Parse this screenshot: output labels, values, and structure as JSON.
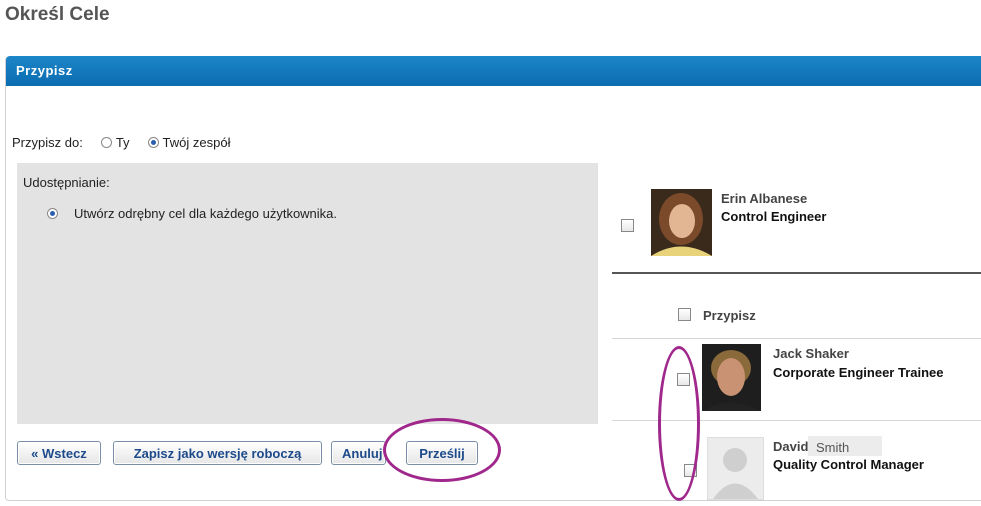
{
  "page": {
    "title": "Określ Cele"
  },
  "panel": {
    "header": "Przypisz"
  },
  "assign": {
    "label": "Przypisz do:",
    "options": [
      {
        "label": "Ty",
        "selected": false
      },
      {
        "label": "Twój zespół",
        "selected": true
      }
    ]
  },
  "sharing": {
    "label": "Udostępnianie:",
    "option": "Utwórz odrębny cel dla każdego użytkownika.",
    "option_selected": true
  },
  "buttons": {
    "back": "« Wstecz",
    "save_draft": "Zapisz jako wersję roboczą",
    "cancel": "Anuluj",
    "submit": "Prześlij"
  },
  "team": {
    "select_all_label": "Przypisz",
    "members": [
      {
        "name": "Erin Albanese",
        "role": "Control Engineer",
        "checked": false,
        "photo": "photo"
      },
      {
        "name": "Jack Shaker",
        "role": "Corporate Engineer Trainee",
        "checked": false,
        "photo": "photo"
      },
      {
        "first_name": "David",
        "last_name": "Smith",
        "role": "Quality Control Manager",
        "checked": false,
        "photo": "placeholder-avatar"
      }
    ]
  },
  "colors": {
    "header_bg": "#0b6cb0",
    "highlight": "#a0288c",
    "button_text": "#1d4a8a"
  }
}
